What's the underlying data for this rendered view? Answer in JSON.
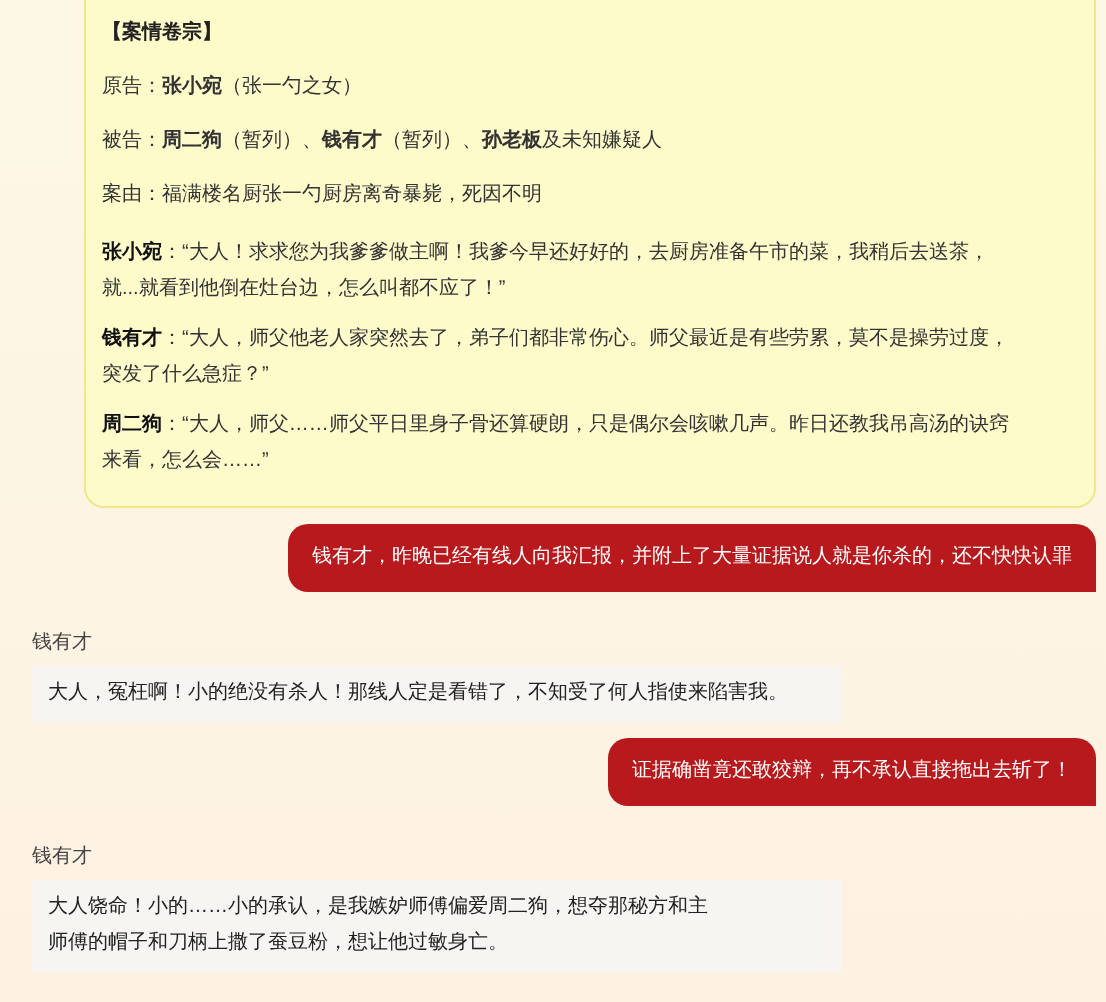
{
  "case_file": {
    "title": "【案情卷宗】",
    "fields": [
      "原告：**张小宛**（张一勺之女）",
      "被告：**周二狗**（暂列）、**钱有才**（暂列）、**孙老板**及未知嫌疑人",
      "案由：福满楼名厨张一勺厨房离奇暴毙，死因不明"
    ],
    "testimonies": [
      {
        "speaker": "张小宛",
        "lines": [
          "：“大人！求求您为我爹爹做主啊！我爹今早还好好的，去厨房准备午市的菜，我稍后去送茶，",
          "就...就看到他倒在灶台边，怎么叫都不应了！”"
        ]
      },
      {
        "speaker": "钱有才",
        "lines": [
          "：“大人，师父他老人家突然去了，弟子们都非常伤心。师父最近是有些劳累，莫不是操劳过度，",
          "突发了什么急症？”"
        ]
      },
      {
        "speaker": "周二狗",
        "lines": [
          "：“大人，师父……师父平日里身子骨还算硬朗，只是偶尔会咳嗽几声。昨日还教我吊高汤的诀窍",
          "来看，怎么会……”"
        ]
      }
    ]
  },
  "messages": [
    {
      "kind": "player",
      "lines": [
        "钱有才，昨晚已经有线人向我汇报，并附上了大量证据说人就是你杀的，还不快快认罪"
      ]
    },
    {
      "kind": "npc",
      "name": "钱有才",
      "lines": [
        "大人，冤枉啊！小的绝没有杀人！那线人定是看错了，不知受了何人指使来陷害我。"
      ]
    },
    {
      "kind": "player",
      "lines": [
        "证据确凿竟还敢狡辩，再不承认直接拖出去斩了！"
      ]
    },
    {
      "kind": "npc",
      "name": "钱有才",
      "lines": [
        "大人饶命！小的……小的承认，是我嫉妒师傅偏爱周二狗，想夺那秘方和主",
        "师傅的帽子和刀柄上撒了蚕豆粉，想让他过敏身亡。"
      ]
    }
  ]
}
